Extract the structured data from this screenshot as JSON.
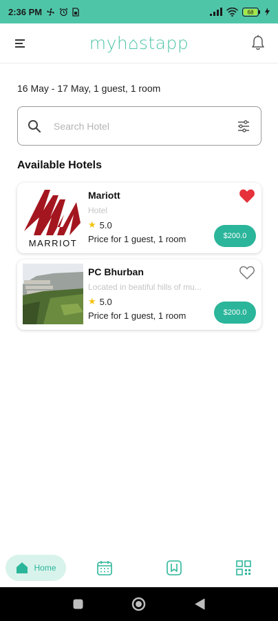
{
  "status_bar": {
    "time": "2:36 PM",
    "battery": "68"
  },
  "header": {
    "logo": "myh⌂stapp"
  },
  "trip": {
    "summary": "16 May - 17 May, 1 guest, 1 room"
  },
  "search": {
    "placeholder": "Search Hotel",
    "value": ""
  },
  "section": {
    "title": "Available Hotels"
  },
  "hotels": [
    {
      "name": "Mariott",
      "subtitle": "Hotel",
      "rating": "5.0",
      "price_label": "Price for 1 guest, 1 room",
      "price": "$200.0",
      "favorited": true,
      "logo_text": "MARRIOT"
    },
    {
      "name": "PC Bhurban",
      "subtitle": "Located in beatiful hills of mu...",
      "rating": "5.0",
      "price_label": "Price for 1 guest, 1 room",
      "price": "$200.0",
      "favorited": false
    }
  ],
  "bottom_nav": {
    "home_label": "Home"
  },
  "colors": {
    "accent": "#2bb59a",
    "status_bar": "#4fc5a8",
    "favorite": "#e5323b"
  }
}
